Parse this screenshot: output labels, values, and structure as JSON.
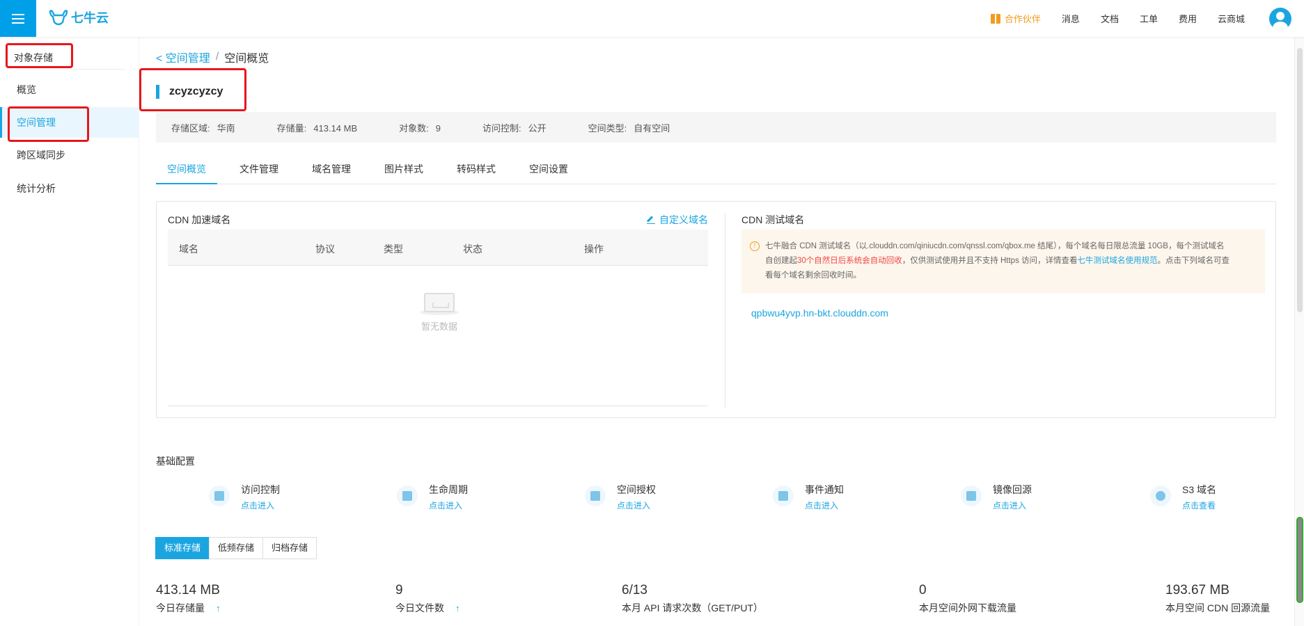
{
  "header": {
    "logo_text": "七牛云",
    "nav": [
      "合作伙伴",
      "消息",
      "文档",
      "工单",
      "费用",
      "云商城"
    ]
  },
  "sidebar": {
    "title": "对象存储",
    "items": [
      {
        "label": "概览"
      },
      {
        "label": "空间管理"
      },
      {
        "label": "跨区域同步"
      },
      {
        "label": "统计分析"
      }
    ]
  },
  "breadcrumb": {
    "parent": "空间管理",
    "separator": "/",
    "current": "空间概览"
  },
  "bucket": {
    "name": "zcyzcyzcy"
  },
  "info": {
    "region_label": "存储区域:",
    "region": "华南",
    "storage_label": "存储量:",
    "storage": "413.14 MB",
    "objects_label": "对象数:",
    "objects": "9",
    "access_label": "访问控制:",
    "access": "公开",
    "type_label": "空间类型:",
    "type": "自有空间"
  },
  "tabs": [
    "空间概览",
    "文件管理",
    "域名管理",
    "图片样式",
    "转码样式",
    "空间设置"
  ],
  "cdn": {
    "accel_title": "CDN 加速域名",
    "custom_domain": "自定义域名",
    "columns": [
      "域名",
      "协议",
      "类型",
      "状态",
      "操作"
    ],
    "empty_text": "暂无数据",
    "test_title": "CDN 测试域名",
    "notice_1": "七牛融合 CDN 测试域名（以.clouddn.com/qiniucdn.com/qnssl.com/qbox.me 结尾），每个域名每日限总流量 10GB，每个测试域名",
    "notice_2a": "自创建起",
    "notice_2_red": "30个自然日后系统会自动回收",
    "notice_2b": "，仅供测试使用并且不支持 Https 访问，详情查看",
    "notice_2_link": "七牛测试域名使用规范",
    "notice_2c": "。点击下列域名可查",
    "notice_3": "看每个域名剩余回收时间。",
    "test_domain": "qpbwu4yvp.hn-bkt.clouddn.com"
  },
  "basic": {
    "title": "基础配置",
    "items": [
      {
        "name": "访问控制",
        "link": "点击进入",
        "icon": "access-control-icon"
      },
      {
        "name": "生命周期",
        "link": "点击进入",
        "icon": "lifecycle-icon"
      },
      {
        "name": "空间授权",
        "link": "点击进入",
        "icon": "bucket-auth-icon"
      },
      {
        "name": "事件通知",
        "link": "点击进入",
        "icon": "event-notify-icon"
      },
      {
        "name": "镜像回源",
        "link": "点击进入",
        "icon": "mirror-source-icon"
      },
      {
        "name": "S3 域名",
        "link": "点击查看",
        "icon": "globe-icon"
      }
    ]
  },
  "storage_tabs": [
    "标准存储",
    "低频存储",
    "归档存储"
  ],
  "stats": [
    {
      "value": "413.14 MB",
      "label": "今日存储量"
    },
    {
      "value": "9",
      "label": "今日文件数"
    },
    {
      "value": "6/13",
      "label": "本月 API 请求次数（GET/PUT）"
    },
    {
      "value": "0",
      "label": "本月空间外网下载流量"
    },
    {
      "value": "193.67 MB",
      "label": "本月空间 CDN 回源流量"
    }
  ],
  "colors": {
    "accent": "#1ba5e0",
    "warning": "#f39b1b",
    "annotation": "#e8161b"
  }
}
